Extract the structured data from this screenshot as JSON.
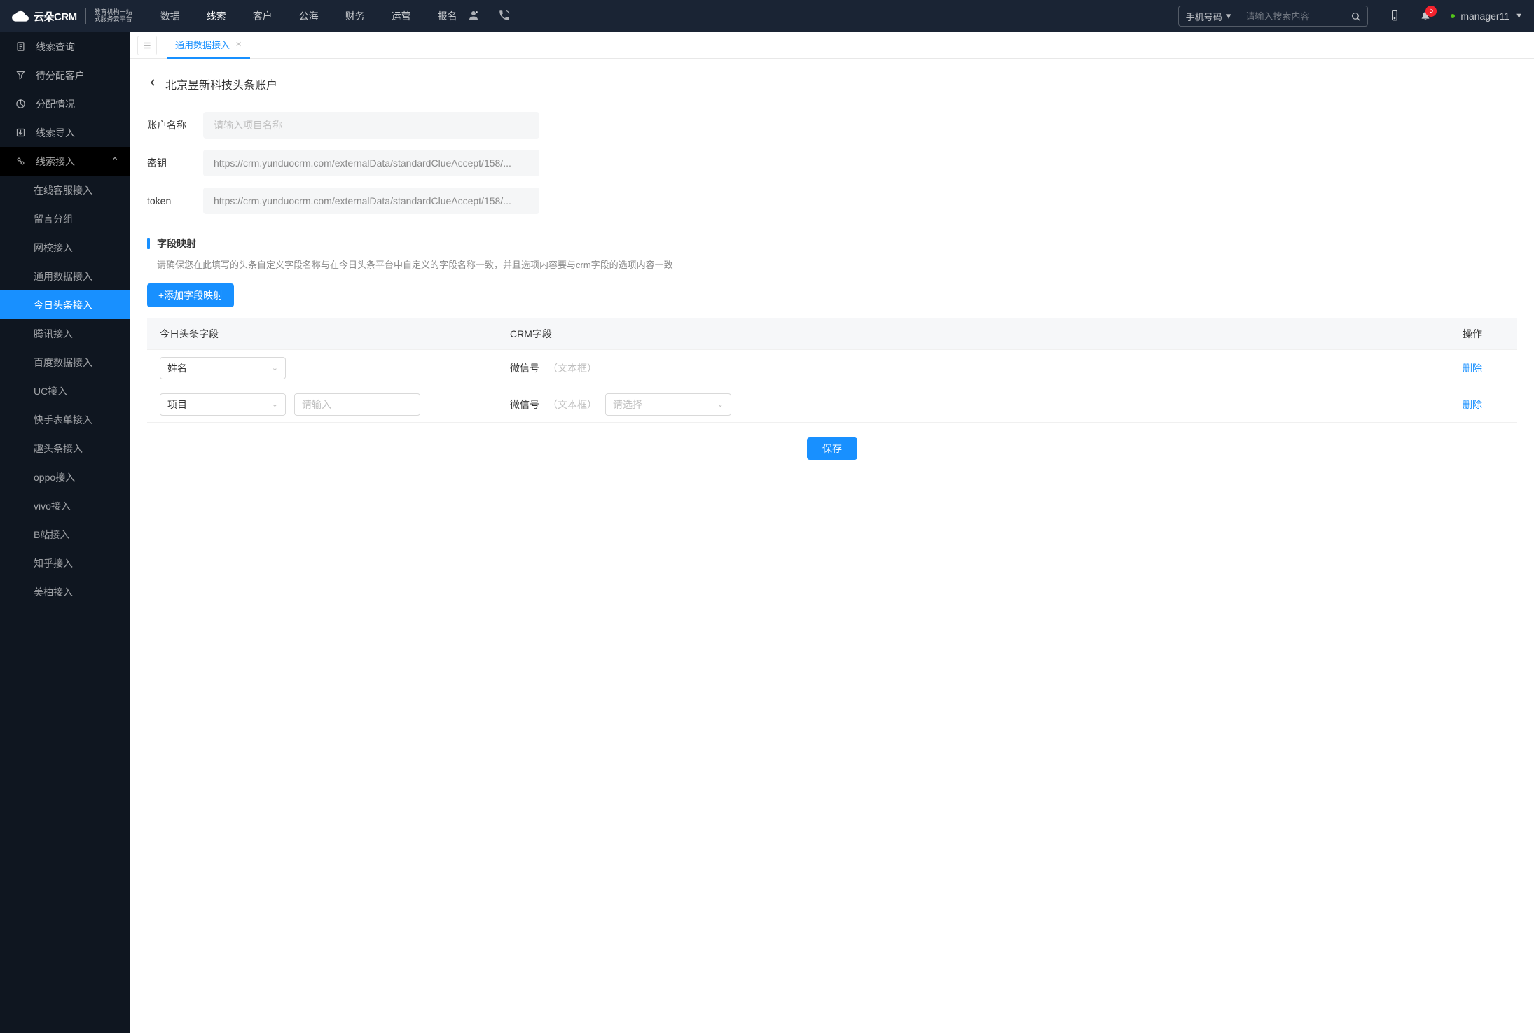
{
  "header": {
    "brand_main": "云朵CRM",
    "brand_sub_line1": "教育机构一站",
    "brand_sub_line2": "式服务云平台",
    "brand_url": "www.yunduocrm.com",
    "nav": [
      "数据",
      "线索",
      "客户",
      "公海",
      "财务",
      "运营",
      "报名"
    ],
    "nav_active": 1,
    "search_type": "手机号码",
    "search_placeholder": "请输入搜索内容",
    "badge": "5",
    "username": "manager11"
  },
  "sidebar": {
    "top": [
      {
        "label": "线索查询",
        "icon": "doc"
      },
      {
        "label": "待分配客户",
        "icon": "filter"
      },
      {
        "label": "分配情况",
        "icon": "chart"
      },
      {
        "label": "线索导入",
        "icon": "import"
      }
    ],
    "group_label": "线索接入",
    "group_icon": "plug",
    "subs": [
      "在线客服接入",
      "留言分组",
      "网校接入",
      "通用数据接入",
      "今日头条接入",
      "腾讯接入",
      "百度数据接入",
      "UC接入",
      "快手表单接入",
      "趣头条接入",
      "oppo接入",
      "vivo接入",
      "B站接入",
      "知乎接入",
      "美柚接入"
    ],
    "sub_active": 4
  },
  "tabs": {
    "active_label": "通用数据接入"
  },
  "page": {
    "title": "北京昱新科技头条账户",
    "labels": {
      "account": "账户名称",
      "secret": "密钥",
      "token": "token"
    },
    "account_placeholder": "请输入项目名称",
    "secret_value": "https://crm.yunduocrm.com/externalData/standardClueAccept/158/...",
    "token_value": "https://crm.yunduocrm.com/externalData/standardClueAccept/158/..."
  },
  "mapping": {
    "section_title": "字段映射",
    "section_desc": "请确保您在此填写的头条自定义字段名称与在今日头条平台中自定义的字段名称一致，并且选项内容要与crm字段的选项内容一致",
    "add_button": "+添加字段映射",
    "columns": {
      "tt": "今日头条字段",
      "crm": "CRM字段",
      "act": "操作"
    },
    "rows": [
      {
        "tt_select": "姓名",
        "tt_input_value": "",
        "tt_input_placeholder": "",
        "crm_label": "微信号",
        "crm_type": "（文本框）",
        "crm_select": null,
        "delete": "删除",
        "show_extra": false
      },
      {
        "tt_select": "项目",
        "tt_input_value": "",
        "tt_input_placeholder": "请输入",
        "crm_label": "微信号",
        "crm_type": "（文本框）",
        "crm_select_placeholder": "请选择",
        "delete": "删除",
        "show_extra": true
      }
    ]
  },
  "footer": {
    "save": "保存"
  }
}
